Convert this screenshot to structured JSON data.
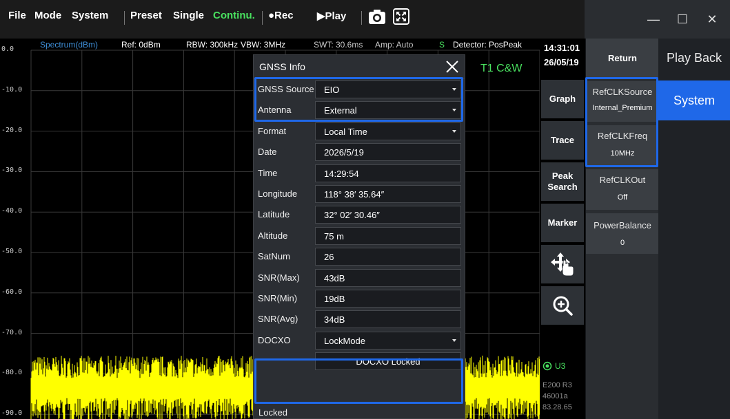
{
  "menu": {
    "file": "File",
    "mode": "Mode",
    "system": "System",
    "preset": "Preset",
    "single": "Single",
    "continu": "Continu.",
    "rec": "●Rec",
    "play": "▶Play",
    "camera_icon": "camera-icon",
    "fullscreen_icon": "fullscreen-icon"
  },
  "window": {
    "minimize": "—",
    "maximize": "☐",
    "close": "✕"
  },
  "spectrum": {
    "title": "Spectrum(dBm)",
    "ref": "Ref: 0dBm",
    "rbw": "RBW: 300kHz",
    "vbw": "VBW: 3MHz",
    "swt": "SWT: 30.6ms",
    "amp": "Amp: Auto",
    "mode_flag": "S",
    "detector": "Detector: PosPeak",
    "trace_label": "T1 C&W",
    "y_ticks": [
      "0.0",
      "-10.0",
      "-20.0",
      "-30.0",
      "-40.0",
      "-50.0",
      "-60.0",
      "-70.0",
      "-80.0",
      "-90.0"
    ],
    "trace_color": "#ffff00",
    "grid_color": "#3a3a3a",
    "grid": true,
    "noise_floor_dbm": -81,
    "noise_span_dbm": 10
  },
  "clock": {
    "time": "14:31:01",
    "date": "26/05/19"
  },
  "tabs": {
    "graph": "Graph",
    "trace": "Trace",
    "peak_search": "Peak Search",
    "marker": "Marker",
    "move_icon": "move-hand-icon",
    "zoom_icon": "zoom-in-icon"
  },
  "status": {
    "unit": "U3",
    "model": "E200 R3",
    "serial": "46001a",
    "version": "83.28.65"
  },
  "softkeys": {
    "return": "Return",
    "refclk_source_label": "RefCLKSource",
    "refclk_source_value": "Internal_Premium",
    "refclk_freq_label": "RefCLKFreq",
    "refclk_freq_value": "10MHz",
    "refclk_out_label": "RefCLKOut",
    "refclk_out_value": "Off",
    "power_balance_label": "PowerBalance",
    "power_balance_value": "0"
  },
  "categories": {
    "play_back": "Play Back",
    "system": "System"
  },
  "dialog": {
    "title": "GNSS Info",
    "rows": [
      {
        "label": "GNSS Source",
        "value": "EIO",
        "select": true
      },
      {
        "label": "Antenna",
        "value": "External",
        "select": true
      },
      {
        "label": "Format",
        "value": "Local Time",
        "select": true
      },
      {
        "label": "Date",
        "value": "2026/5/19",
        "select": false
      },
      {
        "label": "Time",
        "value": "14:29:54",
        "select": false
      },
      {
        "label": "Longitude",
        "value": "118° 38′ 35.64″",
        "select": false
      },
      {
        "label": "Latitude",
        "value": "32° 02′ 30.46″",
        "select": false
      },
      {
        "label": "Altitude",
        "value": "75 m",
        "select": false
      },
      {
        "label": "SatNum",
        "value": "26",
        "select": false
      },
      {
        "label": "SNR(Max)",
        "value": "43dB",
        "select": false
      },
      {
        "label": "SNR(Min)",
        "value": "19dB",
        "select": false
      },
      {
        "label": "SNR(Avg)",
        "value": "34dB",
        "select": false
      },
      {
        "label": "DOCXO",
        "value": "LockMode",
        "select": true
      },
      {
        "label": "",
        "value": "DOCXO Locked",
        "select": false,
        "centered": true
      }
    ],
    "lock_status": "Locked"
  },
  "colors": {
    "accent": "#1f68e8",
    "green": "#49e15f",
    "trace": "#ffff00"
  }
}
